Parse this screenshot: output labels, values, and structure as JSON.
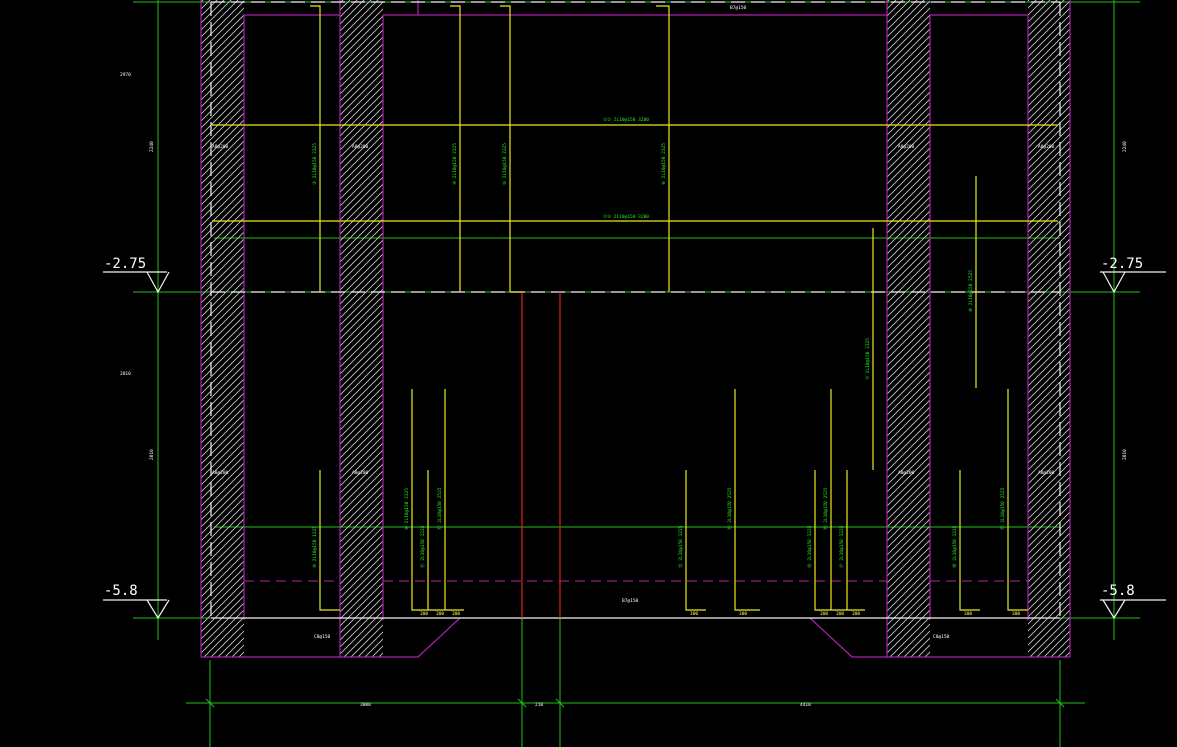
{
  "levels": {
    "upper_left": "-2.75",
    "upper_right": "-2.75",
    "lower_left": "-5.8",
    "lower_right": "-5.8"
  },
  "dims": {
    "left_top": "2970",
    "left_mid": "2240",
    "left_bot": "2010",
    "bottom_left": "3000",
    "bottom_mid": "210",
    "bottom_right": "4410",
    "right_upper": "2240",
    "right_lower": "2010"
  },
  "wall_tags": {
    "a": "A8@200",
    "b": "A8@200",
    "c": "A8@200",
    "d": "A8@200",
    "e": "A8@200",
    "f": "A8@200",
    "g": "A8@200",
    "h": "A8@200"
  },
  "rebar_labels": {
    "h_top": "①② 2L10@150 3200",
    "h_mid": "①③ 2L10@150 3200",
    "v1": "③ 2L10@150 2325",
    "v2": "④ 2L10@150 2325",
    "v3": "⑤ 2L10@150 2325",
    "v4": "⑥ 2L10@150 2325",
    "v5": "⑦ 2L10@150 2325",
    "v6": "⑧ 2L10@150 2525",
    "b1": "⑨ 2L10@150 1225",
    "b2": "⑩ 2L10@150 2325",
    "b3": "⑪ 2L10@150 1225",
    "b4": "⑫ 2L10@150 2525",
    "b5": "⑬ 2L10@150 1225",
    "b6": "⑭ 2L10@150 2525",
    "b7": "⑮ 2L10@150 1225",
    "b8": "⑯ 2L10@150 2525",
    "b9": "⑰ 2L10@150 1225",
    "b10": "⑱ 2L10@150 1225",
    "b11": "⑲ 2L10@150 2525"
  },
  "notes": {
    "top_note": "B7@150",
    "mid_note": "B7@150",
    "bot_left": "C8@150",
    "bot_right": "C8@150",
    "hook": "300"
  }
}
